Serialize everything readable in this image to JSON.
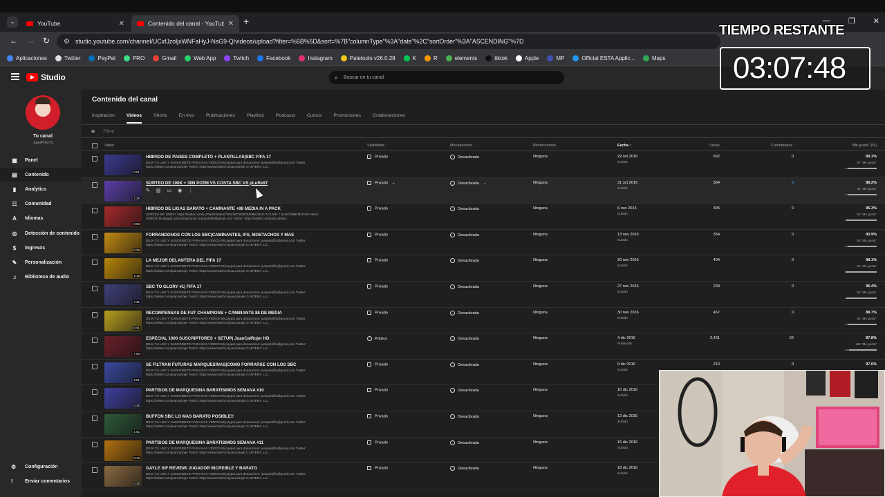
{
  "browser": {
    "tabs": [
      {
        "label": "YouTube"
      },
      {
        "label": "Contenido del canal - YouTube"
      }
    ],
    "new_tab": "+",
    "url": "studio.youtube.com/channel/UCxfJzoljxWNFaHyJ-NsG9-Q/videos/upload?filter=%5B%5D&sort=%7B\"columnType\"%3A\"date\"%2C\"sortOrder\"%3A\"ASCENDING\"%7D",
    "bookmarks": [
      "Aplicaciones",
      "Twitter",
      "PayPal",
      "PRO",
      "Gmail",
      "Web App",
      "Twitch",
      "Facebook",
      "Instagram",
      "Paletools v26.0.28",
      "K",
      "R",
      "elements",
      "tiktok",
      "Apple",
      "MP",
      "Official ESTA Applic...",
      "Maps"
    ]
  },
  "studio": {
    "logo_text": "Studio",
    "search_placeholder": "Buscar en tu canal",
    "channel_label": "Tu canal",
    "channel_handle": "JuanPolo71",
    "nav": [
      "Panel",
      "Contenido",
      "Analytics",
      "Comunidad",
      "Idiomas",
      "Detección de contenido",
      "Ingresos",
      "Personalización",
      "Biblioteca de audio"
    ],
    "footer": [
      "Configuración",
      "Enviar comentarios"
    ],
    "page_title": "Contenido del canal",
    "tabs": [
      "Inspiración",
      "Videos",
      "Shorts",
      "En vivo",
      "Publicaciones",
      "Playlists",
      "Podcasts",
      "Cursos",
      "Promociones",
      "Colaboraciones"
    ],
    "filter_placeholder": "Filtrar",
    "columns": {
      "video": "Video",
      "visibility": "Visibilidad",
      "monetization": "Monetización",
      "restrictions": "Restricciones",
      "date": "Fecha",
      "views": "Vistas",
      "comments": "Comentarios",
      "likes": "\"Me gusta\" (%)"
    },
    "videos": [
      {
        "title": "HIBRIDO DE PAISES COMPLETO + PLANTILLAS|SBC FIFA 17",
        "desc": "DEJA TU LIKE Y SUSCRIBETE PARA MAS VIDEOS Mi paypal para donaciones: juanpolofifa@gmail.com Twitter:\nhttps://twitter.com/juancalrojer Twitch: https://www.twitch.tv/juancalrojer CANTERA: LU...",
        "duration": "5:51",
        "visibility": "Privado",
        "monetization": "Desactivada",
        "restrictions": "Ninguna",
        "date": "29 oct 2016",
        "status": "Subido",
        "views": "662",
        "comments": "0",
        "like_pct": "89.1%",
        "likes": "57 \"Me gusta\"",
        "like_ratio": 0.891
      },
      {
        "title": "SORTEO DE 100K + 30N POTM VS COSTA SBC VS pLuRe97",
        "desc": "",
        "duration": "4:29",
        "visibility": "Privado",
        "monetization": "Desactivada",
        "restrictions": "Ninguna",
        "date": "31 oct 2016",
        "status": "Subido",
        "views": "364",
        "comments": "0",
        "like_pct": "88.2%",
        "likes": "45 \"Me gusta\"",
        "like_ratio": 0.882
      },
      {
        "title": "HIBRIDO DE LIGAS BARATO + CAMINANTE +88 MEDIA IN A PACK",
        "desc": "SORTEO DE 100K!!!: https://twitter.com/LuF9e97/status/79343670029754098 DEJA TU LIKE Y SUSCRIBETE PARA MAS\nVIDEOS Mi paypal para donaciones: juanpolofifa@gmail.com Twitter: https://twitter.com/juancalrojer...",
        "duration": "3:06",
        "visibility": "Privado",
        "monetization": "Desactivada",
        "restrictions": "Ninguna",
        "date": "6 nov 2016",
        "status": "Subido",
        "views": "395",
        "comments": "0",
        "like_pct": "96.3%",
        "likes": "53 \"Me gusta\"",
        "like_ratio": 0.963
      },
      {
        "title": "FORRANDONOS CON LOS SBC|CAMINANTES, IFS, MOSTACHOS Y MAS",
        "desc": "DEJA TU LIKE Y SUSCRIBETE PARA MAS VIDEOS Mi paypal para donaciones: juanpolofifa@gmail.com Twitter:\nhttps://twitter.com/juancalrojer Twitch: https://www.twitch.tv/juancalrojer CANTERA: LU...",
        "duration": "5:25",
        "visibility": "Privado",
        "monetization": "Desactivada",
        "restrictions": "Ninguna",
        "date": "13 nov 2016",
        "status": "Subido",
        "views": "354",
        "comments": "0",
        "like_pct": "90.9%",
        "likes": "50 \"Me gusta\"",
        "like_ratio": 0.909
      },
      {
        "title": "LA MEJOR DELANTERA DEL FIFA 17",
        "desc": "DEJA TU LIKE Y SUSCRIBETE PARA MAS VIDEOS Mi paypal para donaciones: juanpolofifa@gmail.com Twitter:\nhttps://twitter.com/juancalrojer Twitch: https://www.twitch.tv/juancalrojer CANTERA: LU...",
        "duration": "4:16",
        "visibility": "Privado",
        "monetization": "Desactivada",
        "restrictions": "Ninguna",
        "date": "20 nov 2016",
        "status": "Subido",
        "views": "404",
        "comments": "0",
        "like_pct": "98.1%",
        "likes": "51 \"Me gusta\"",
        "like_ratio": 0.981
      },
      {
        "title": "SBC TO GLORY #1| FIFA 17",
        "desc": "DEJA TU LIKE Y SUSCRIBETE PARA MAS VIDEOS Mi paypal para donaciones: juanpolofifa@gmail.com Twitter:\nhttps://twitter.com/juancalrojer Twitch: https://www.twitch.tv/juancalrojer CANTERA: LU...",
        "duration": "7:31",
        "visibility": "Privado",
        "monetization": "Desactivada",
        "restrictions": "Ninguna",
        "date": "27 nov 2016",
        "status": "Subido",
        "views": "239",
        "comments": "0",
        "like_pct": "96.4%",
        "likes": "53 \"Me gusta\"",
        "like_ratio": 0.964
      },
      {
        "title": "RECOMPENSAS DE FUT CHAMPIONS + CAMINANTE 88 DE MEDIA",
        "desc": "DEJA TU LIKE Y SUSCRIBETE PARA MAS VIDEOS Mi paypal para donaciones: juanpolofifa@gmail.com Twitter:\nhttps://twitter.com/juancalrojer Twitch: https://www.twitch.tv/juancalrojer CANTERA: LU...",
        "duration": "5:21",
        "visibility": "Privado",
        "monetization": "Desactivada",
        "restrictions": "Ninguna",
        "date": "30 nov 2016",
        "status": "Subido",
        "views": "467",
        "comments": "0",
        "like_pct": "88.7%",
        "likes": "55 \"Me gusta\"",
        "like_ratio": 0.887
      },
      {
        "title": "ESPECIAL 1000 SUSCRIPTORES + SETUP| JuanCalRojer HD",
        "desc": "DEJA TU LIKE Y SUSCRIBETE PARA MAS VIDEOS Mi paypal para donaciones: juanpolofifa@gmail.com Twitter:\nhttps://twitter.com/juancalrojer Twitch: https://www.twitch.tv/juancalrojer CANTERA: LU...",
        "duration": "7:00",
        "visibility": "Público",
        "monetization": "Desactivada",
        "restrictions": "Ninguna",
        "date": "4 dic 2016",
        "status": "Publicado",
        "views": "2,431",
        "comments": "62",
        "like_pct": "87.8%",
        "likes": "186 \"Me gusta\"",
        "like_ratio": 0.878
      },
      {
        "title": "SE FILTRAN FUTURAS MARQUESINAS|COMO FORRARSE CON LOS SBC",
        "desc": "DEJA TU LIKE Y SUSCRIBETE PARA MAS VIDEOS Mi paypal para donaciones: juanpolofifa@gmail.com Twitter:\nhttps://twitter.com/juancalrojer Twitch: https://www.twitch.tv/juancalrojer CANTERA: LU...",
        "duration": "2:51",
        "visibility": "Privado",
        "monetization": "Desactivada",
        "restrictions": "Ninguna",
        "date": "9 dic 2016",
        "status": "Subido",
        "views": "213",
        "comments": "0",
        "like_pct": "97.6%",
        "likes": "",
        "like_ratio": 0.976
      },
      {
        "title": "PARTIDOS DE MARQUESINA BARATISIMOS SEMANA #10",
        "desc": "DEJA TU LIKE Y SUSCRIBETE PARA MAS VIDEOS Mi paypal para donaciones: juanpolofifa@gmail.com Twitter:\nhttps://twitter.com/juancalrojer Twitch: https://www.twitch.tv/juancalrojer CANTERA: LU...",
        "duration": "5:35",
        "visibility": "Privado",
        "monetization": "Desactivada",
        "restrictions": "Ninguna",
        "date": "10 dic 2016",
        "status": "Subido",
        "views": "",
        "comments": "",
        "like_pct": "",
        "likes": "",
        "like_ratio": 0
      },
      {
        "title": "BUFFON SBC LO MAS BARATO POSIBLE!!",
        "desc": "DEJA TU LIKE Y SUSCRIBETE PARA MAS VIDEOS Mi paypal para donaciones: juanpolofifa@gmail.com Twitter:\nhttps://twitter.com/juancalrojer Twitch: https://www.twitch.tv/juancalrojer CANTERA: LU...",
        "duration": "1:51",
        "visibility": "Privado",
        "monetization": "Desactivada",
        "restrictions": "Ninguna",
        "date": "13 dic 2016",
        "status": "Subido",
        "views": "",
        "comments": "",
        "like_pct": "",
        "likes": "",
        "like_ratio": 0
      },
      {
        "title": "PARTIDOS DE MARQUESINA BARATISIMOS SEMANA #11",
        "desc": "DEJA TU LIKE Y SUSCRIBETE PARA MAS VIDEOS Mi paypal para donaciones: juanpolofifa@gmail.com Twitter:\nhttps://twitter.com/juancalrojer Twitch: https://www.twitch.tv/juancalrojer CANTERA: LU...",
        "duration": "6:10",
        "visibility": "Privado",
        "monetization": "Desactivada",
        "restrictions": "Ninguna",
        "date": "16 dic 2016",
        "status": "Subido",
        "views": "",
        "comments": "",
        "like_pct": "",
        "likes": "",
        "like_ratio": 0
      },
      {
        "title": "GAYLE SIF REVIEW/ JUGADOR INCREIBLE Y BARATO",
        "desc": "DEJA TU LIKE Y SUSCRIBETE PARA MAS VIDEOS Mi paypal para donaciones: juanpolofifa@gmail.com Twitter:\nhttps://twitter.com/juancalrojer Twitch: https://www.twitch.tv/juancalrojer CANTERA: LU...",
        "duration": "8:38",
        "visibility": "Privado",
        "monetization": "Desactivada",
        "restrictions": "Ninguna",
        "date": "18 dic 2016",
        "status": "Subido",
        "views": "",
        "comments": "",
        "like_pct": "",
        "likes": "",
        "like_ratio": 0
      }
    ]
  },
  "overlay": {
    "timer_label": "TIEMPO RESTANTE",
    "timer_value": "03:07:48"
  },
  "colors": {
    "brand": "#ff0000",
    "link_comment": "#3ea6ff",
    "thumb_palette": [
      "#3b3a8e",
      "#5a3fa8",
      "#a52a2a",
      "#c28a12",
      "#b8860b",
      "#40407a",
      "#b8a020",
      "#6b1f2a",
      "#3a4aa0",
      "#4040a0",
      "#2e5a3a",
      "#b07010",
      "#8a6a40"
    ]
  },
  "icons": {
    "sidebar": [
      "dashboard-icon",
      "content-icon",
      "analytics-icon",
      "community-icon",
      "languages-icon",
      "content-detection-icon",
      "earn-icon",
      "customization-icon",
      "audio-library-icon"
    ]
  }
}
